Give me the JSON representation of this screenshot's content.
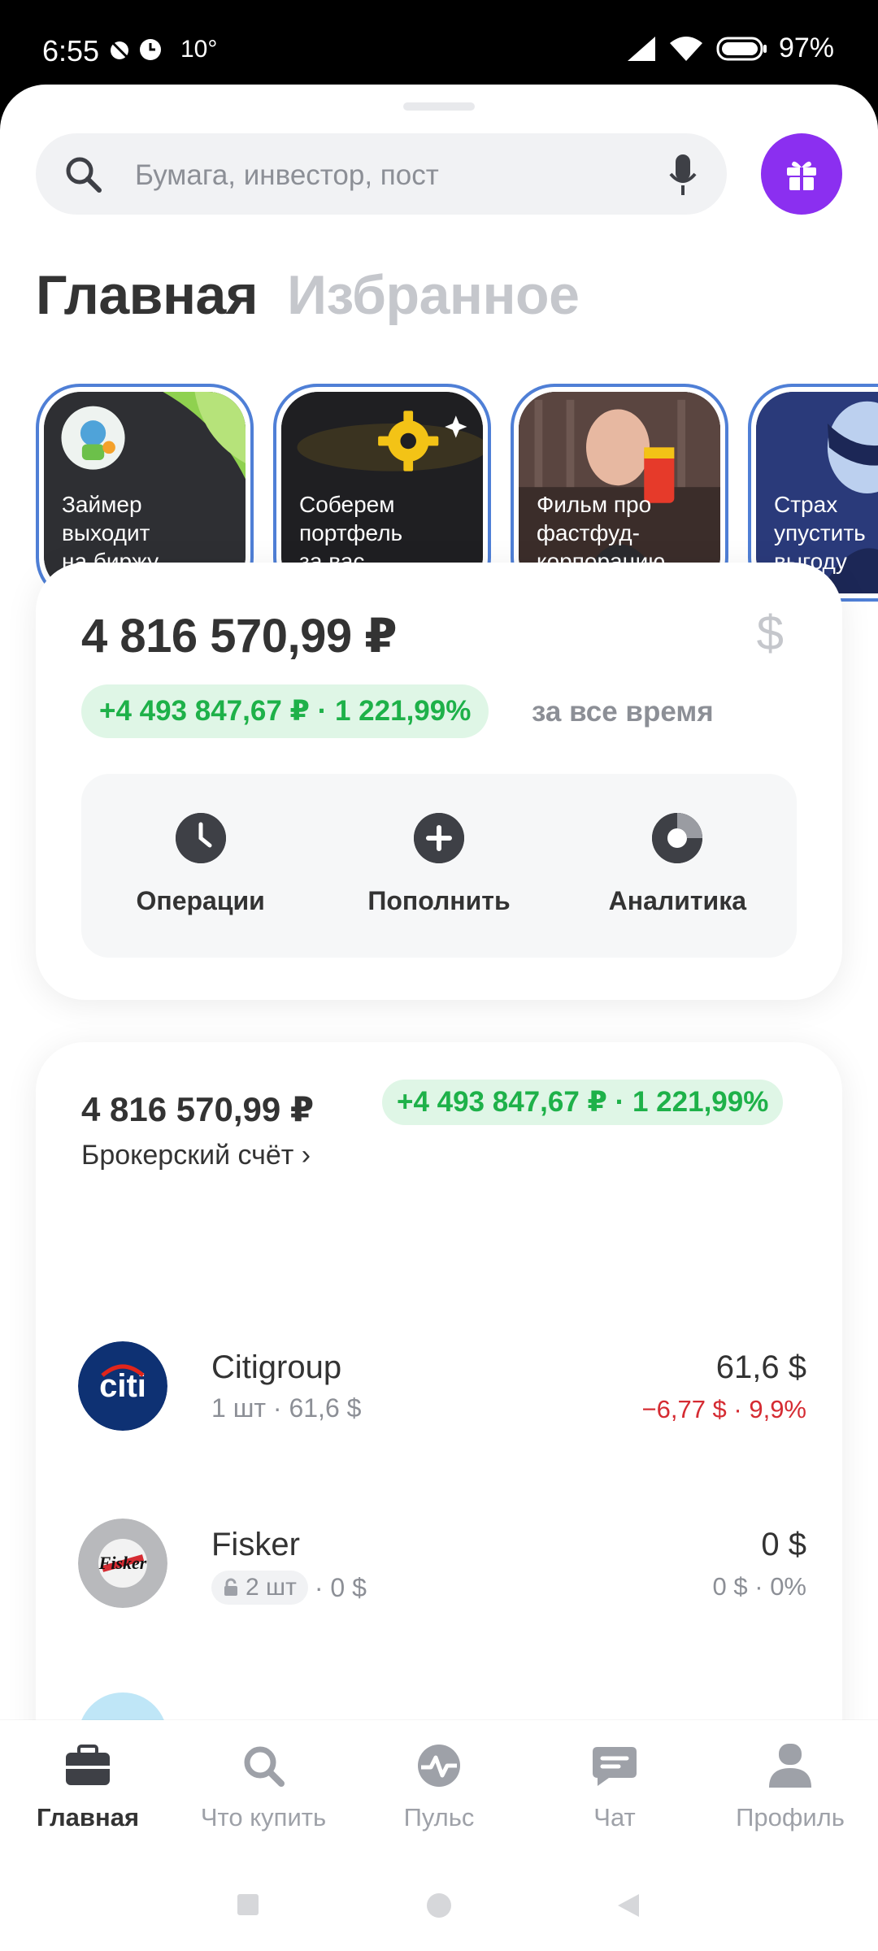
{
  "status_bar": {
    "time": "6:55",
    "temperature": "10°",
    "battery": "97%"
  },
  "search": {
    "placeholder": "Бумага, инвестор, пост"
  },
  "tabs": [
    {
      "label": "Главная",
      "active": true
    },
    {
      "label": "Избранное",
      "active": false
    }
  ],
  "stories": [
    {
      "text": "Займер выходит на биржу",
      "lines": [
        "Займер",
        "выходит",
        "на биржу"
      ]
    },
    {
      "text": "Соберем портфель за вас",
      "lines": [
        "Соберем",
        "портфель",
        "за вас"
      ]
    },
    {
      "text": "Фильм про фастфуд-корпорацию",
      "lines": [
        "Фильм про",
        "фастфуд-",
        "корпорацию"
      ]
    },
    {
      "text": "Страх упустить выгоду",
      "lines": [
        "Страх",
        "упустить",
        "выгоду"
      ]
    }
  ],
  "balance": {
    "amount": "4 816 570,99 ₽",
    "currency_toggle": "$",
    "gain": "+4 493 847,67 ₽ · 1 221,99%",
    "period": "за все время",
    "actions": [
      {
        "label": "Операции",
        "icon": "clock-icon"
      },
      {
        "label": "Пополнить",
        "icon": "plus-icon"
      },
      {
        "label": "Аналитика",
        "icon": "donut-chart-icon"
      }
    ]
  },
  "portfolio": {
    "amount": "4 816 570,99 ₽",
    "gain": "+4 493 847,67 ₽ · 1 221,99%",
    "account": "Брокерский счёт ›",
    "assets": [
      {
        "name": "Citigroup",
        "sub": "1 шт · 61,6 $",
        "price": "61,6 $",
        "change": "−6,77 $ · 9,9%",
        "change_color": "#d52b32"
      },
      {
        "name": "Fisker",
        "qty": "2 шт",
        "sub_rest": "· 0 $",
        "price": "0 $",
        "change": "0 $ · 0%",
        "change_color": "#8c8f96"
      }
    ]
  },
  "bottom_nav": [
    {
      "label": "Главная",
      "icon": "briefcase-icon",
      "active": true
    },
    {
      "label": "Что купить",
      "icon": "search-icon",
      "active": false
    },
    {
      "label": "Пульс",
      "icon": "pulse-icon",
      "active": false
    },
    {
      "label": "Чат",
      "icon": "chat-icon",
      "active": false
    },
    {
      "label": "Профиль",
      "icon": "profile-icon",
      "active": false
    }
  ],
  "colors": {
    "accent_purple": "#8b2ff0",
    "gain_green": "#1eb149",
    "loss_red": "#d52b32",
    "story_border": "#4f7fd6"
  }
}
